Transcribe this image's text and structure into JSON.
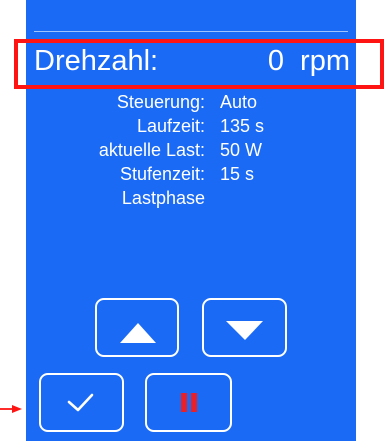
{
  "speed": {
    "label": "Drehzahl:",
    "value": "0  rpm"
  },
  "info": [
    {
      "label": "Steuerung:",
      "value": "Auto"
    },
    {
      "label": "Laufzeit:",
      "value": "135 s"
    },
    {
      "label": "aktuelle Last:",
      "value": "50 W"
    },
    {
      "label": "Stufenzeit:",
      "value": "15 s"
    },
    {
      "label": "Lastphase",
      "value": ""
    }
  ],
  "buttons": {
    "up_icon": "triangle-up-icon",
    "down_icon": "triangle-down-icon",
    "confirm_icon": "checkmark-icon",
    "pause_icon": "pause-icon"
  },
  "colors": {
    "panel": "#1b6af5",
    "text": "#ffffff",
    "highlight": "#ff1414",
    "pause": "#e8202a"
  }
}
